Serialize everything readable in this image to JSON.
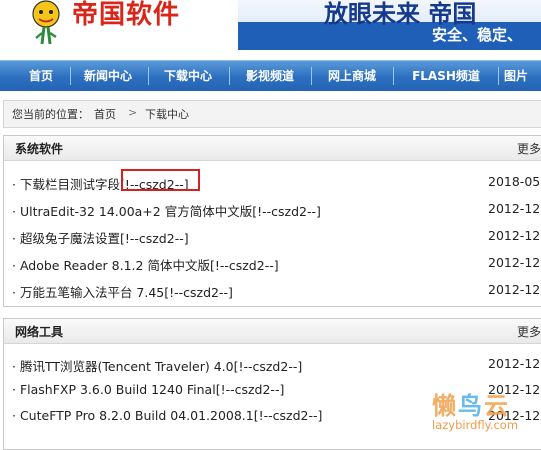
{
  "site": {
    "logo_text": "帝国软件",
    "banner_title": "放眼未来 帝国",
    "banner_sub": "安全、稳定、"
  },
  "nav": [
    "首页",
    "新闻中心",
    "下载中心",
    "影视频道",
    "网上商城",
    "FLASH频道",
    "图片"
  ],
  "breadcrumb": {
    "prefix": "您当前的位置：",
    "home": "首页",
    "sep": ">",
    "current": "下载中心"
  },
  "sections": [
    {
      "title": "系统软件",
      "more": "更多",
      "items": [
        {
          "title": "· 下载栏目测试字段[!--cszd2--]",
          "date": "2018-05"
        },
        {
          "title": "· UltraEdit-32 14.00a+2 官方简体中文版[!--cszd2--]",
          "date": "2012-12"
        },
        {
          "title": "· 超级兔子魔法设置[!--cszd2--]",
          "date": "2012-12"
        },
        {
          "title": "· Adobe Reader 8.1.2 简体中文版[!--cszd2--]",
          "date": "2012-12"
        },
        {
          "title": "· 万能五笔输入法平台 7.45[!--cszd2--]",
          "date": "2012-12"
        }
      ]
    },
    {
      "title": "网络工具",
      "more": "更多",
      "items": [
        {
          "title": "· 腾讯TT浏览器(Tencent Traveler) 4.0[!--cszd2--]",
          "date": "2012-12"
        },
        {
          "title": "· FlashFXP 3.6.0 Build 1240 Final[!--cszd2--]",
          "date": "2012-12"
        },
        {
          "title": "· CuteFTP Pro 8.2.0 Build 04.01.2008.1[!--cszd2--]",
          "date": "2012-12"
        }
      ]
    }
  ],
  "watermark": {
    "cn": "懒鸟云",
    "url": "lazybirdfly.com"
  },
  "colors": {
    "nav_bg": "#2c6fc0",
    "logo_red": "#d8261a",
    "highlight_box": "#d32020",
    "watermark_orange": "#ef9a48"
  }
}
